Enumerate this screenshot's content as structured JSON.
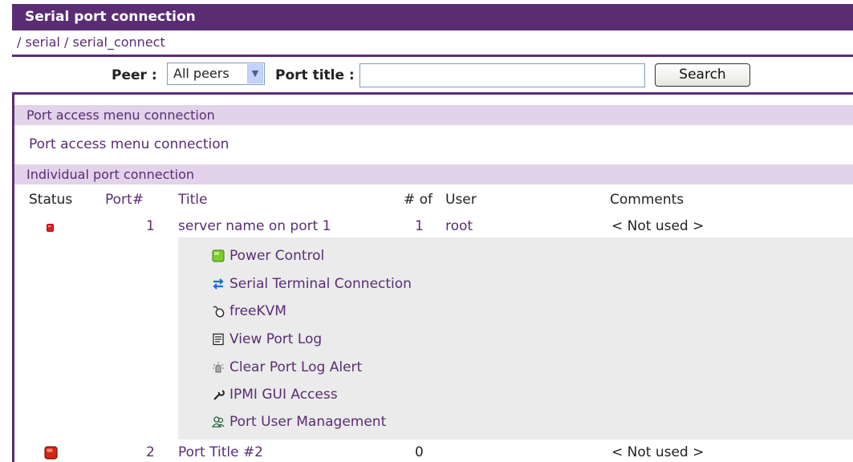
{
  "header": {
    "title": "Serial port connection"
  },
  "breadcrumb": {
    "text": "/ serial / serial_connect"
  },
  "search": {
    "peer_label": "Peer :",
    "peer_value": "All peers",
    "port_title_label": "Port title :",
    "port_title_value": "",
    "search_button": "Search"
  },
  "sections": {
    "menu_header": "Port access menu connection",
    "menu_link": "Port access menu connection",
    "individual_header": "Individual port connection"
  },
  "table": {
    "headers": {
      "status": "Status",
      "port": "Port#",
      "title": "Title",
      "count": "# of",
      "user": "User",
      "comments": "Comments"
    },
    "rows": [
      {
        "status_color": "#e02020",
        "port": "1",
        "title": "server name on port 1",
        "count": "1",
        "user": "root",
        "comments": "< Not used >"
      },
      {
        "status_color": "#d02818",
        "port": "2",
        "title": "Port Title #2",
        "count": "0",
        "user": "",
        "comments": "< Not used >"
      }
    ]
  },
  "port_menu": [
    {
      "label": "Power Control",
      "icon": "power-icon"
    },
    {
      "label": "Serial Terminal Connection",
      "icon": "arrows-icon"
    },
    {
      "label": "freeKVM",
      "icon": "mouse-icon"
    },
    {
      "label": "View Port Log",
      "icon": "log-icon"
    },
    {
      "label": "Clear Port Log Alert",
      "icon": "alert-light-icon"
    },
    {
      "label": "IPMI GUI Access",
      "icon": "wrench-icon"
    },
    {
      "label": "Port User Management",
      "icon": "users-icon"
    }
  ],
  "colors": {
    "brand": "#5a2d73",
    "section_bg": "#e2d2ea",
    "submenu_bg": "#ebebeb"
  }
}
